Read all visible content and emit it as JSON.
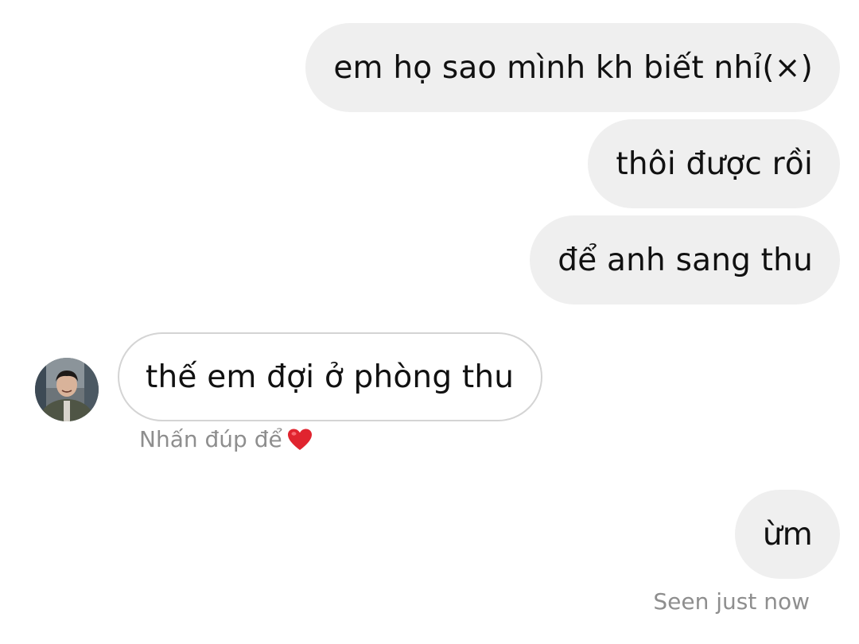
{
  "messages": {
    "outgoing_1": "em họ sao mình kh biết nhỉ(×)",
    "outgoing_2": "thôi được rồi",
    "outgoing_3": "để anh sang thu",
    "incoming_1": "thế em đợi ở phòng thu",
    "outgoing_4": "ừm"
  },
  "hint": {
    "text": "Nhấn đúp để",
    "icon": "heart-icon",
    "icon_color": "#e0242f"
  },
  "status": {
    "seen": "Seen just now"
  },
  "colors": {
    "outgoing_bubble": "#efefef",
    "incoming_border": "#d4d4d4",
    "meta_text": "#8e8e8e"
  }
}
